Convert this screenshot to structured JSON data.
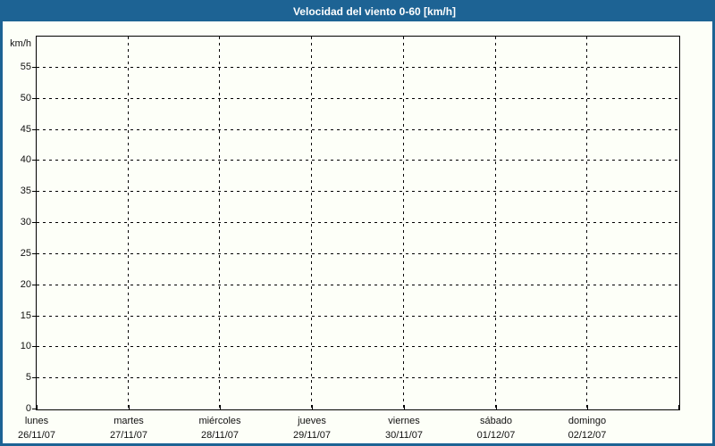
{
  "window": {
    "title": "Velocidad del viento 0-60 [km/h]"
  },
  "theme": {
    "titlebar_color": "#1d6394",
    "border_color": "#1d6394",
    "background_color": "#fdfff8",
    "axis_color": "#000000",
    "title_text_color": "#ffffff",
    "label_text_color": "#111111"
  },
  "chart_data": {
    "type": "line",
    "title": "Velocidad del viento 0-60 [km/h]",
    "ylabel": "km/h",
    "ylim": [
      0,
      60
    ],
    "yticks": [
      0,
      5,
      10,
      15,
      20,
      25,
      30,
      35,
      40,
      45,
      50,
      55
    ],
    "grid": "dashed",
    "legend": "none",
    "x_categories": [
      {
        "day": "lunes",
        "date": "26/11/07"
      },
      {
        "day": "martes",
        "date": "27/11/07"
      },
      {
        "day": "miércoles",
        "date": "28/11/07"
      },
      {
        "day": "jueves",
        "date": "29/11/07"
      },
      {
        "day": "viernes",
        "date": "30/11/07"
      },
      {
        "day": "sábado",
        "date": "01/12/07"
      },
      {
        "day": "domingo",
        "date": "02/12/07"
      }
    ],
    "series": []
  }
}
